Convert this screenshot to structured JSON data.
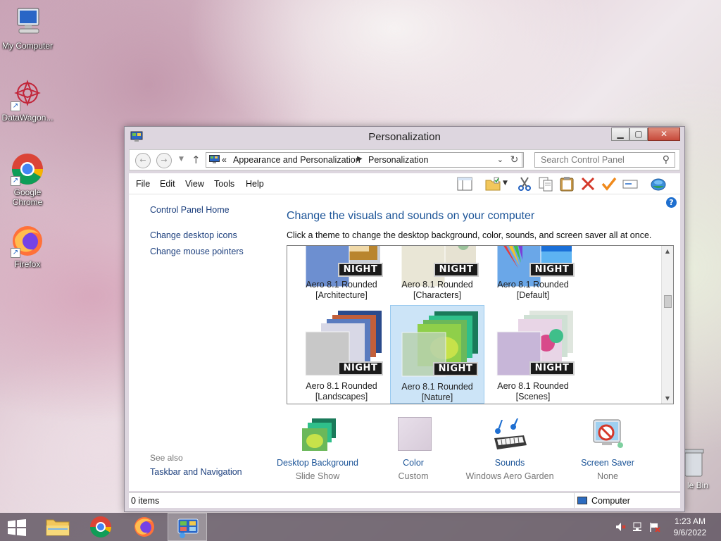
{
  "desktop": {
    "icons": [
      {
        "label": "My Computer"
      },
      {
        "label": "DataWagon..."
      },
      {
        "label": "Google Chrome"
      },
      {
        "label": "Firefox"
      }
    ],
    "recycle_bin_partial_label": "le Bin"
  },
  "window": {
    "title": "Personalization",
    "address": {
      "overflow": "«",
      "crumbs": [
        "Appearance and Personalization",
        "Personalization"
      ]
    },
    "search": {
      "placeholder": "Search Control Panel"
    },
    "menu": [
      "File",
      "Edit",
      "View",
      "Tools",
      "Help"
    ],
    "left_pane": {
      "home": "Control Panel Home",
      "links": [
        "Change desktop icons",
        "Change mouse pointers"
      ],
      "see_also_heading": "See also",
      "see_also_links": [
        "Taskbar and Navigation"
      ]
    },
    "main": {
      "heading": "Change the visuals and sounds on your computer",
      "subtext": "Click a theme to change the desktop background, color, sounds, and screen saver all at once."
    },
    "themes": [
      {
        "line1": "Aero 8.1 Rounded",
        "line2": "[Architecture]",
        "badge": "NIGHT"
      },
      {
        "line1": "Aero 8.1 Rounded",
        "line2": "[Characters]",
        "badge": "NIGHT"
      },
      {
        "line1": "Aero 8.1 Rounded",
        "line2": "[Default]",
        "badge": "NIGHT"
      },
      {
        "line1": "Aero 8.1 Rounded",
        "line2": "[Landscapes]",
        "badge": "NIGHT"
      },
      {
        "line1": "Aero 8.1 Rounded",
        "line2": "[Nature]",
        "badge": "NIGHT",
        "selected": true
      },
      {
        "line1": "Aero 8.1 Rounded",
        "line2": "[Scenes]",
        "badge": "NIGHT"
      }
    ],
    "bottom": [
      {
        "label": "Desktop Background",
        "value": "Slide Show"
      },
      {
        "label": "Color",
        "value": "Custom"
      },
      {
        "label": "Sounds",
        "value": "Windows Aero Garden"
      },
      {
        "label": "Screen Saver",
        "value": "None"
      }
    ],
    "status": {
      "count": "0 items",
      "zone": "Computer"
    }
  },
  "taskbar": {
    "time": "1:23 AM",
    "date": "9/6/2022"
  },
  "colors": {
    "link": "#1d5598",
    "selection": "#cce4f7",
    "close_button": "#c74a3b"
  }
}
